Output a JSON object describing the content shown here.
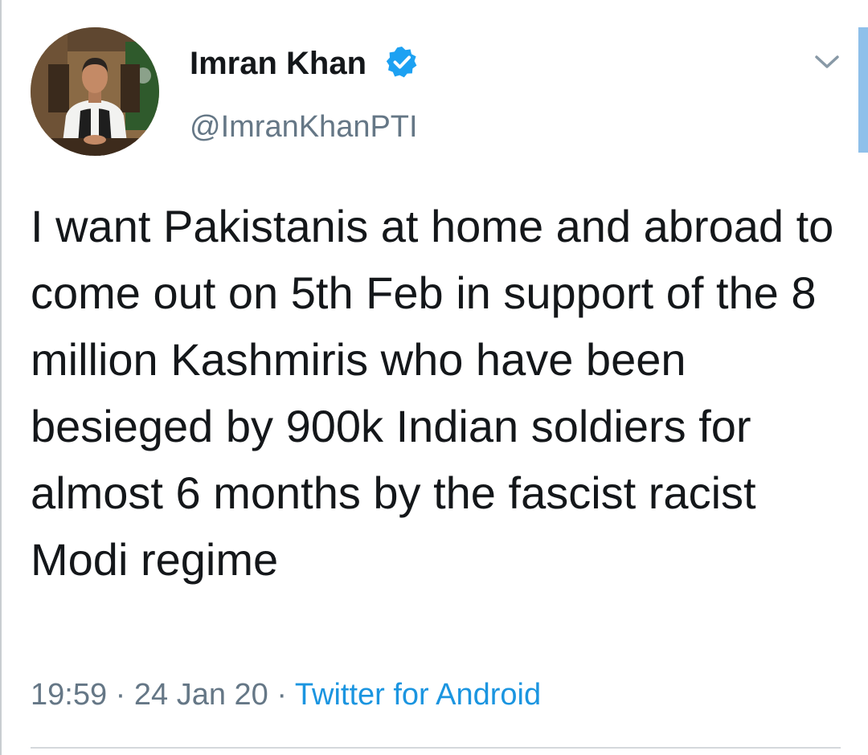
{
  "author": {
    "display_name": "Imran Khan",
    "handle": "@ImranKhanPTI",
    "verified": true,
    "avatar_icon": "profile-photo"
  },
  "tweet": {
    "text": "I want Pakistanis at home and abroad to come out on 5th Feb in support of the 8 million Kashmiris who have been besieged by 900k Indian soldiers for almost 6 months by the fascist racist Modi regime",
    "time": "19:59",
    "date": "24 Jan 20",
    "separator": "·",
    "source": "Twitter for Android"
  },
  "menu": {
    "icon": "chevron-down-icon"
  },
  "colors": {
    "text": "#14171a",
    "secondary": "#657786",
    "link": "#1b95e0",
    "verified": "#1da1f2"
  }
}
